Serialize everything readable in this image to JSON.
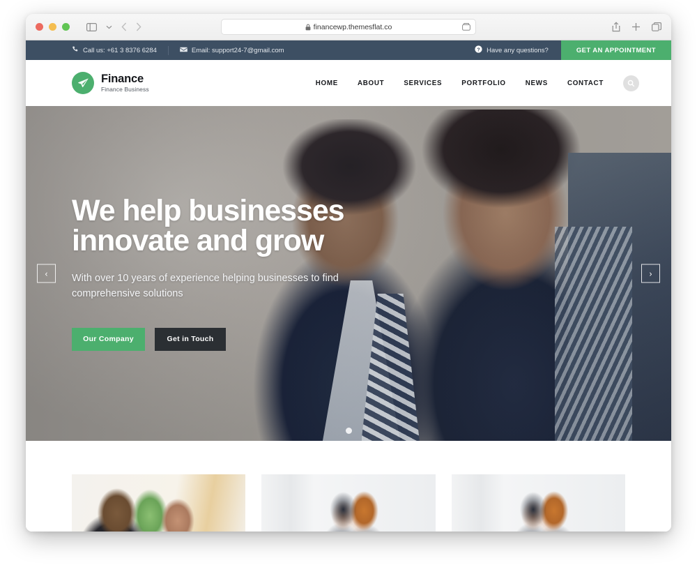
{
  "browser": {
    "url": "financewp.themesflat.co",
    "lock_icon": "lock-icon",
    "reader_icon": "reader-view-icon",
    "shield_icon": "privacy-shield-icon",
    "sidebar_icon": "sidebar-toggle-icon",
    "chevron_icon": "chevron-down-icon",
    "back_icon": "back-arrow-icon",
    "forward_icon": "forward-arrow-icon",
    "share_icon": "share-icon",
    "newtab_icon": "plus-icon",
    "tabs_icon": "tab-overview-icon"
  },
  "topbar": {
    "phone": "Call us: +61 3 8376 6284",
    "email": "Email: support24-7@gmail.com",
    "questions": "Have any questions?",
    "appointment": "GET AN APPOINTMENT",
    "bg_color": "#3d4f63",
    "accent_color": "#4caf6e"
  },
  "header": {
    "brand": "Finance",
    "tagline": "Finance Business",
    "nav": [
      {
        "label": "HOME"
      },
      {
        "label": "ABOUT"
      },
      {
        "label": "SERVICES"
      },
      {
        "label": "PORTFOLIO"
      },
      {
        "label": "NEWS"
      },
      {
        "label": "CONTACT"
      }
    ]
  },
  "hero": {
    "heading_line1": "We help businesses",
    "heading_line2": "innovate and grow",
    "subtitle_line1": "With over 10 years of experience helping businesses to find",
    "subtitle_line2": "comprehensive solutions",
    "primary_button": "Our Company",
    "secondary_button": "Get in Touch",
    "prev_label": "‹",
    "next_label": "›"
  },
  "cards": [
    {
      "alt": "business meeting photo one"
    },
    {
      "alt": "business meeting photo two"
    },
    {
      "alt": "business meeting photo three"
    }
  ]
}
